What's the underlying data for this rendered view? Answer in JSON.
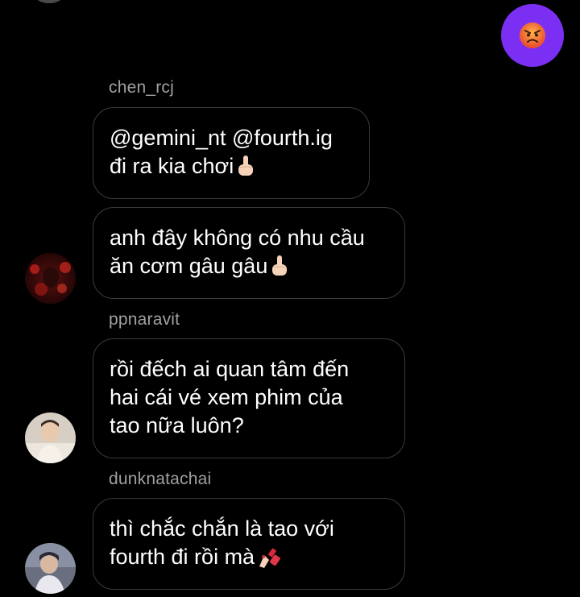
{
  "reaction": {
    "emoji_icon": "angry-face-icon",
    "bubble_color": "#7b2ff2"
  },
  "messages": [
    {
      "sender": "chen_rcj",
      "lines": [
        "@gemini_nt @fourth.ig",
        "đi ra kia chơi"
      ],
      "trailing_emoji": "middle-finger-icon"
    },
    {
      "sender": "",
      "lines": [
        "anh đây không có nhu cầu",
        "ăn cơm gâu gâu"
      ],
      "trailing_emoji": "middle-finger-icon"
    },
    {
      "sender": "ppnaravit",
      "lines": [
        "rồi đếch ai quan tâm đến",
        "hai cái vé xem phim của",
        "tao nữa luôn?"
      ],
      "trailing_emoji": ""
    },
    {
      "sender": "dunknatachai",
      "lines": [
        "thì chắc chắn là tao với",
        "fourth đi rồi mà"
      ],
      "trailing_emoji": "nail-polish-icon"
    }
  ],
  "colors": {
    "background": "#000000",
    "bubble_border": "#3a3a3a",
    "sender_text": "#a0a0a0",
    "message_text": "#ffffff"
  }
}
